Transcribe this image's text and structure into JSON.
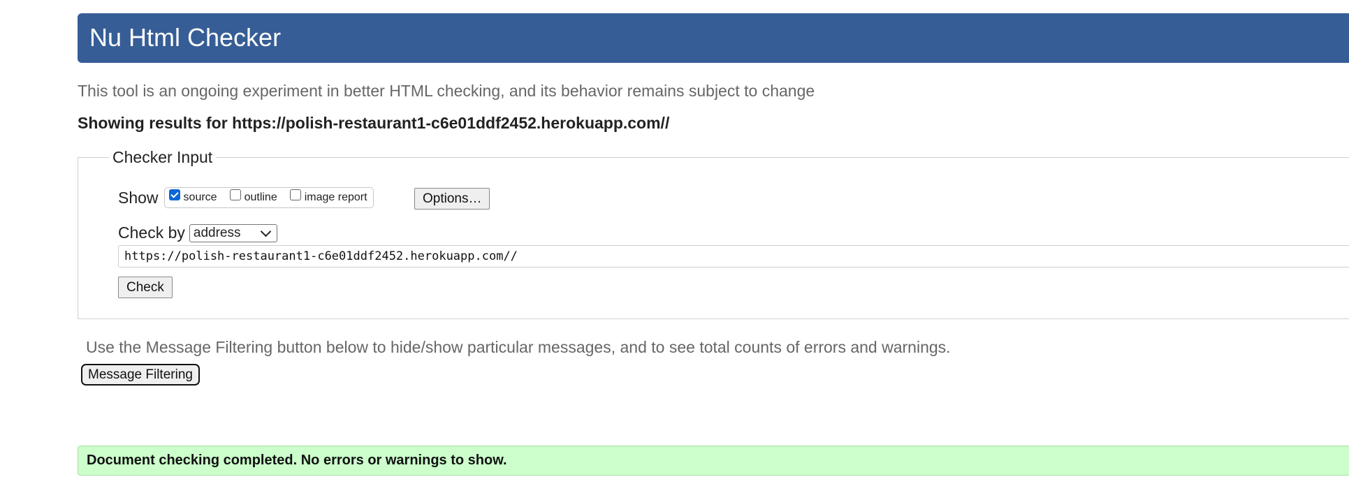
{
  "header": {
    "title": "Nu Html Checker"
  },
  "intro": "This tool is an ongoing experiment in better HTML checking, and its behavior remains subject to change",
  "results_heading": "Showing results for https://polish-restaurant1-c6e01ddf2452.herokuapp.com//",
  "checker": {
    "legend": "Checker Input",
    "show_label": "Show",
    "options": [
      {
        "label": "source",
        "checked": true
      },
      {
        "label": "outline",
        "checked": false
      },
      {
        "label": "image report",
        "checked": false
      }
    ],
    "options_button": "Options…",
    "check_by_label": "Check by",
    "check_by_value": "address",
    "address_value": "https://polish-restaurant1-c6e01ddf2452.herokuapp.com//",
    "check_button": "Check"
  },
  "filter": {
    "note": "Use the Message Filtering button below to hide/show particular messages, and to see total counts of errors and warnings.",
    "button": "Message Filtering"
  },
  "status": {
    "message": "Document checking completed. No errors or warnings to show.",
    "color": "#ccffcc"
  },
  "colors": {
    "header_bg": "#365d95",
    "checkbox_accent": "#0b67d6"
  }
}
